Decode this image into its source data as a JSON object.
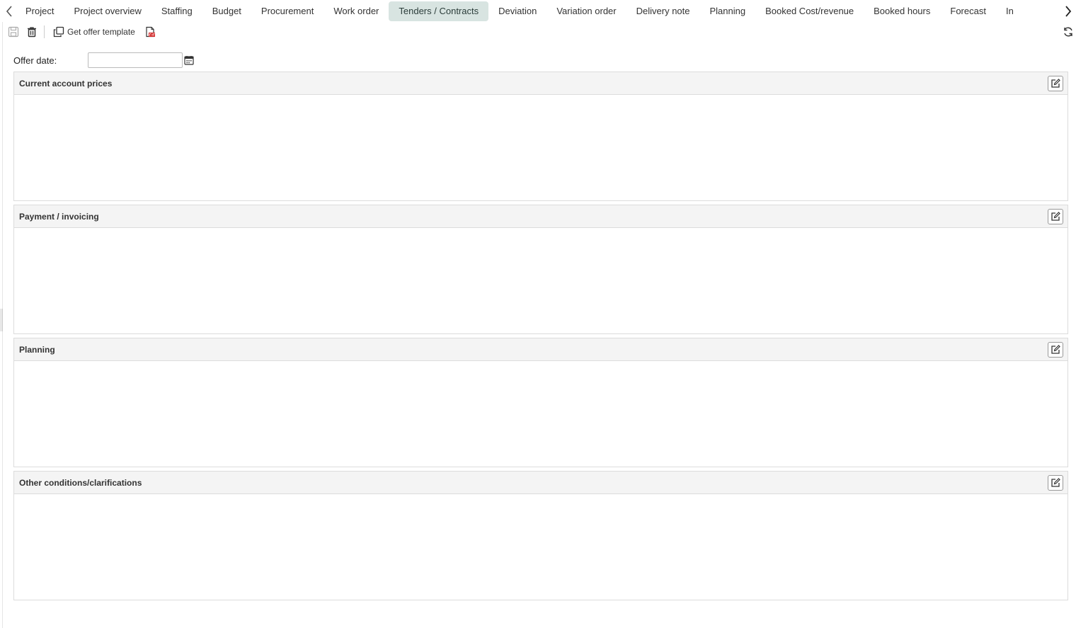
{
  "tabs": [
    {
      "label": "Project"
    },
    {
      "label": "Project overview"
    },
    {
      "label": "Staffing"
    },
    {
      "label": "Budget"
    },
    {
      "label": "Procurement"
    },
    {
      "label": "Work order"
    },
    {
      "label": "Tenders / Contracts",
      "active": true
    },
    {
      "label": "Deviation"
    },
    {
      "label": "Variation order"
    },
    {
      "label": "Delivery note"
    },
    {
      "label": "Planning"
    },
    {
      "label": "Booked Cost/revenue"
    },
    {
      "label": "Booked hours"
    },
    {
      "label": "Forecast"
    },
    {
      "label": "In"
    }
  ],
  "toolbar": {
    "get_offer_template_label": "Get offer template",
    "icons": [
      "save-icon",
      "trash-icon",
      "copy-icon",
      "pdf-icon",
      "refresh-icon"
    ]
  },
  "offer_date": {
    "label": "Offer date:",
    "value": ""
  },
  "sections": [
    {
      "title": "Current account prices"
    },
    {
      "title": "Payment / invoicing"
    },
    {
      "title": "Planning"
    },
    {
      "title": "Other conditions/clarifications"
    }
  ],
  "colors": {
    "active_tab_bg": "#d8e4e1",
    "section_header_bg": "#f4f4f4",
    "border": "#dcdcdc",
    "pdf_red": "#d32f2f"
  }
}
